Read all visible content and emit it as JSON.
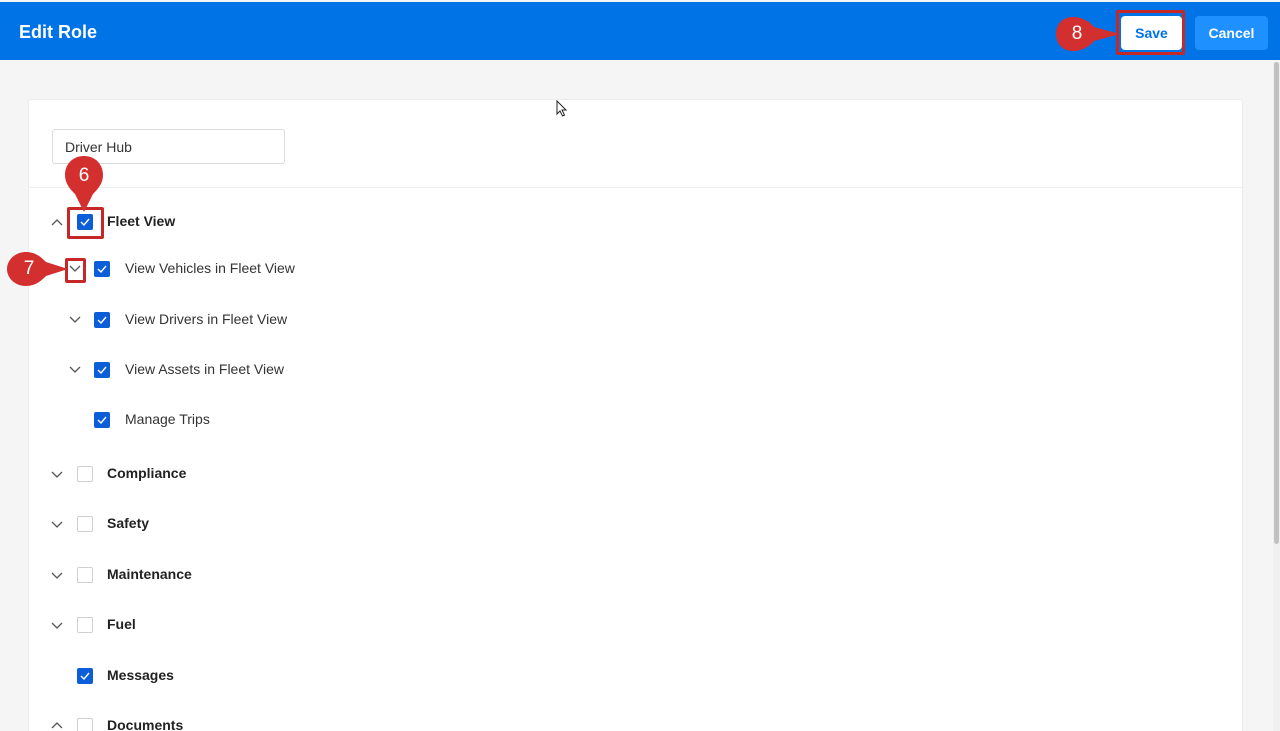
{
  "header": {
    "title": "Edit Role",
    "save_label": "Save",
    "cancel_label": "Cancel",
    "color": "#0073e6"
  },
  "role_name": {
    "value": "Driver Hub"
  },
  "tree": {
    "fleet_view": {
      "label": "Fleet View",
      "checked": true,
      "expanded": true,
      "children": [
        {
          "label": "View Vehicles in Fleet View",
          "checked": true
        },
        {
          "label": "View Drivers in Fleet View",
          "checked": true
        },
        {
          "label": "View Assets in Fleet View",
          "checked": true
        },
        {
          "label": "Manage Trips",
          "checked": true
        }
      ]
    },
    "compliance": {
      "label": "Compliance",
      "checked": false
    },
    "safety": {
      "label": "Safety",
      "checked": false
    },
    "maintenance": {
      "label": "Maintenance",
      "checked": false
    },
    "fuel": {
      "label": "Fuel",
      "checked": false
    },
    "messages": {
      "label": "Messages",
      "checked": true
    },
    "documents": {
      "label": "Documents",
      "checked": false
    }
  },
  "callouts": {
    "step6": "6",
    "step7": "7",
    "step8": "8"
  },
  "colors": {
    "accent": "#0b5ed7",
    "callout": "#d32f2f"
  }
}
